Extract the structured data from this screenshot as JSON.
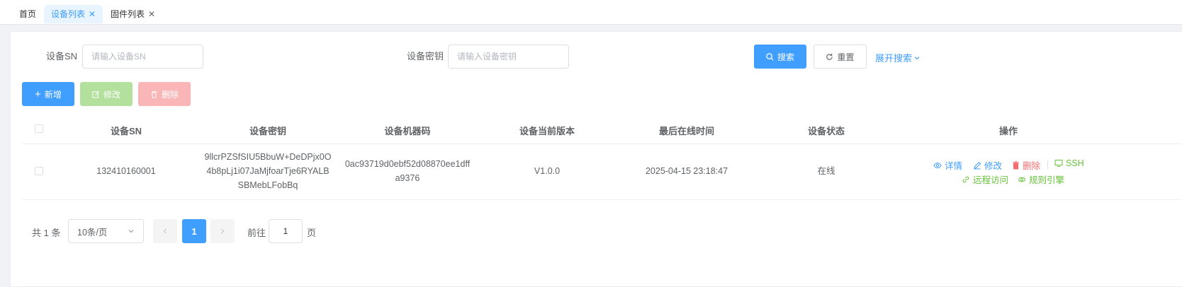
{
  "tabs": [
    {
      "label": "首页",
      "active": false,
      "closable": false
    },
    {
      "label": "设备列表",
      "active": true,
      "closable": true
    },
    {
      "label": "固件列表",
      "active": false,
      "closable": true
    }
  ],
  "search": {
    "sn_label": "设备SN",
    "sn_placeholder": "请输入设备SN",
    "key_label": "设备密钥",
    "key_placeholder": "请输入设备密钥",
    "search_button": "搜索",
    "reset_button": "重置",
    "expand_link": "展开搜索"
  },
  "toolbar": {
    "add": "新增",
    "edit": "修改",
    "delete": "删除"
  },
  "table": {
    "columns": [
      "设备SN",
      "设备密钥",
      "设备机器码",
      "设备当前版本",
      "最后在线时间",
      "设备状态",
      "操作"
    ],
    "rows": [
      {
        "sn": "132410160001",
        "key_lines": [
          "9llcrPZSfSIU5BbuW+DeDPjx0O",
          "4b8pLj1i07JaMjfoarTje6RYALB",
          "SBMebLFobBq"
        ],
        "machine_lines": [
          "0ac93719d0ebf52d08870ee1dff",
          "a9376"
        ],
        "version": "V1.0.0",
        "last_online": "2025-04-15 23:18:47",
        "status": "在线",
        "actions": {
          "detail": "详情",
          "edit": "修改",
          "delete": "删除",
          "ssh": "SSH",
          "remote": "远程访问",
          "rules": "规则引擎"
        }
      }
    ]
  },
  "pagination": {
    "total_text": "共 1 条",
    "page_size": "10条/页",
    "current_page": "1",
    "goto_label": "前往",
    "goto_value": "1",
    "page_unit": "页"
  },
  "colors": {
    "primary": "#409eff",
    "success_disabled": "#b3e19d",
    "danger_disabled": "#fab6b6",
    "danger": "#f56c6c",
    "success": "#67c23a"
  }
}
